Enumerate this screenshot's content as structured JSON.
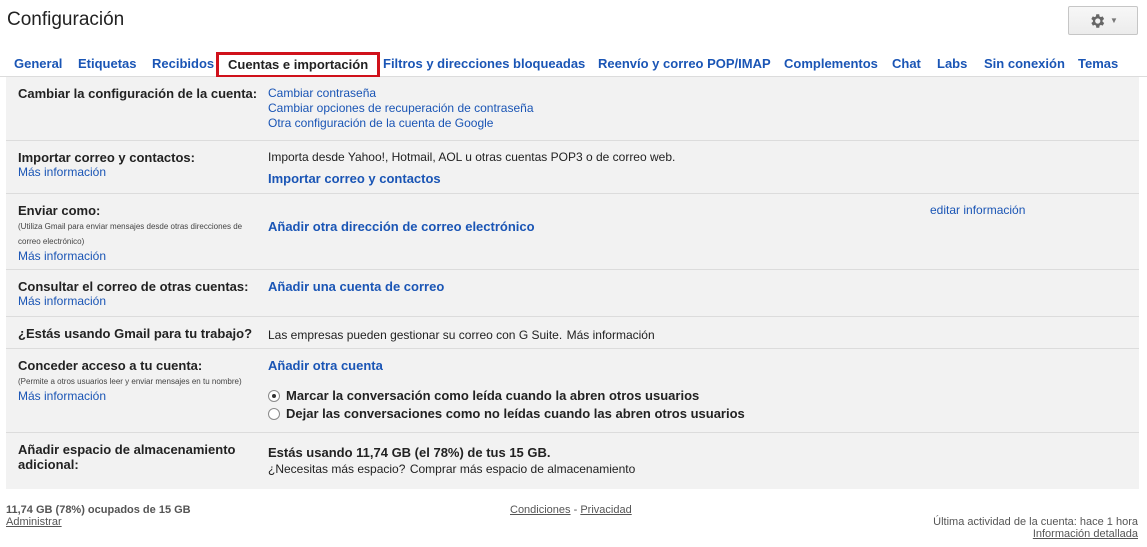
{
  "header": {
    "title": "Configuración",
    "settings_icon": "gear-icon",
    "dropdown_icon": "caret-down-icon"
  },
  "tabs": [
    {
      "label": "General"
    },
    {
      "label": "Etiquetas"
    },
    {
      "label": "Recibidos"
    },
    {
      "label": "Cuentas e importación",
      "active": true
    },
    {
      "label": "Filtros y direcciones bloqueadas"
    },
    {
      "label": "Reenvío y correo POP/IMAP"
    },
    {
      "label": "Complementos"
    },
    {
      "label": "Chat"
    },
    {
      "label": "Labs"
    },
    {
      "label": "Sin conexión"
    },
    {
      "label": "Temas"
    }
  ],
  "rows": {
    "account": {
      "label": "Cambiar la configuración de la cuenta:",
      "links": [
        "Cambiar contraseña",
        "Cambiar opciones de recuperación de contraseña",
        "Otra configuración de la cuenta de Google"
      ]
    },
    "import": {
      "label": "Importar correo y contactos:",
      "more": "Más información",
      "text": "Importa desde Yahoo!, Hotmail, AOL u otras cuentas POP3 o de correo web.",
      "action": "Importar correo y contactos"
    },
    "send_as": {
      "label": "Enviar como:",
      "desc": "(Utiliza Gmail para enviar mensajes desde otras direcciones de correo electrónico)",
      "more": "Más información",
      "action": "Añadir otra dirección de correo electrónico",
      "edit": "editar información"
    },
    "check_mail": {
      "label": "Consultar el correo de otras cuentas:",
      "more": "Más información",
      "action": "Añadir una cuenta de correo"
    },
    "work": {
      "label": "¿Estás usando Gmail para tu trabajo?",
      "text": "Las empresas pueden gestionar su correo con G Suite.",
      "link": "Más información"
    },
    "grant": {
      "label": "Conceder acceso a tu cuenta:",
      "desc": "(Permite a otros usuarios leer y enviar mensajes en tu nombre)",
      "more": "Más información",
      "action": "Añadir otra cuenta",
      "radio1": "Marcar la conversación como leída cuando la abren otros usuarios",
      "radio2": "Dejar las conversaciones como no leídas cuando las abren otros usuarios",
      "selected": "radio1"
    },
    "storage": {
      "label": "Añadir espacio de almacenamiento adicional:",
      "usage": "Estás usando 11,74 GB (el 78%) de tus 15 GB.",
      "question": "¿Necesitas más espacio?",
      "link": "Comprar más espacio de almacenamiento"
    }
  },
  "footer": {
    "storage": "11,74 GB (78%) ocupados de 15 GB",
    "manage": "Administrar",
    "terms": "Condiciones",
    "separator": "-",
    "privacy": "Privacidad",
    "activity": "Última actividad de la cuenta: hace 1 hora",
    "details": "Información detallada"
  },
  "colors": {
    "link": "#1a55b5",
    "active_tab_border": "#d0111b",
    "row_bg": "#f2f2f2"
  }
}
